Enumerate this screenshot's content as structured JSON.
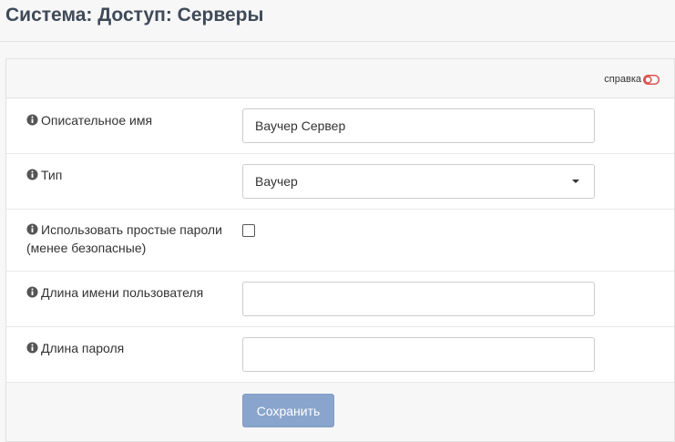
{
  "header": {
    "title": "Система: Доступ: Серверы"
  },
  "panel": {
    "help_label": "справка"
  },
  "form": {
    "descriptive_name": {
      "label": "Описательное имя",
      "value": "Ваучер Сервер"
    },
    "type": {
      "label": "Тип",
      "value": "Ваучер"
    },
    "simple_passwords": {
      "label": "Использовать простые пароли (менее безопасные)",
      "checked": false
    },
    "username_length": {
      "label": "Длина имени пользователя",
      "value": ""
    },
    "password_length": {
      "label": "Длина пароля",
      "value": ""
    }
  },
  "actions": {
    "save_label": "Сохранить"
  },
  "colors": {
    "title": "#3f4a58",
    "save_button": "#8aa5cd",
    "help_toggle": "#d9534f"
  },
  "icons": {
    "info": "info-circle-icon",
    "help": "toggle-off-icon",
    "select": "caret-down-icon"
  }
}
